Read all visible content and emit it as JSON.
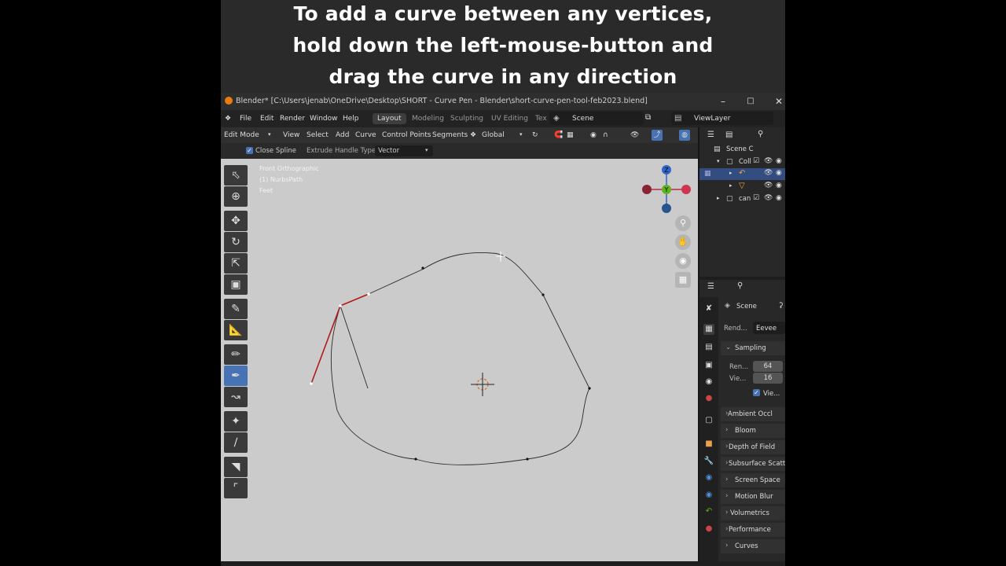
{
  "caption": {
    "line1": "To add a curve between any vertices,",
    "line2": "hold down the left-mouse-button and",
    "line3": "drag the curve in any direction"
  },
  "window": {
    "title": "Blender* [C:\\Users\\jenab\\OneDrive\\Desktop\\SHORT - Curve Pen - Blender\\short-curve-pen-tool-feb2023.blend]",
    "min_icon": "minimize-icon",
    "max_icon": "maximize-icon",
    "close_icon": "close-icon"
  },
  "menubar": {
    "items": [
      "File",
      "Edit",
      "Render",
      "Window",
      "Help"
    ],
    "workspaces": [
      "Layout",
      "Modeling",
      "Sculpting",
      "UV Editing",
      "Tex"
    ],
    "active_workspace": "Layout",
    "scene": "Scene",
    "view_layer": "ViewLayer"
  },
  "header": {
    "mode": "Edit Mode",
    "menus": [
      "View",
      "Select",
      "Add",
      "Curve",
      "Control Points",
      "Segments"
    ],
    "transform_orientation": "Global"
  },
  "tool_settings": {
    "close_spline_label": "Close Spline",
    "close_spline_checked": true,
    "extrude_label": "Extrude Handle Type:",
    "extrude_value": "Vector"
  },
  "viewport": {
    "view_name": "Front Orthographic",
    "object_name": "(1) NurbsPath",
    "units": "Feet",
    "gizmo_axes": {
      "z": "Z",
      "y": "Y"
    },
    "colors": {
      "background": "#cbcbcb",
      "curve": "#2a2a2a",
      "handle": "#b11a1a",
      "active_tool": "#4772b3"
    }
  },
  "outliner": {
    "rows": [
      "Scene C",
      "Coll",
      "",
      "",
      "can"
    ]
  },
  "properties": {
    "scene_label": "Scene",
    "render_engine_label": "Rend...",
    "render_engine_value": "Eevee",
    "sampling_label": "Sampling",
    "render_samples_label": "Ren...",
    "render_samples_value": "64",
    "viewport_samples_label": "Vie...",
    "viewport_samples_value": "16",
    "viewport_denoise_label": "Vie...",
    "panels": [
      "Ambient Occl",
      "Bloom",
      "Depth of Field",
      "Subsurface Scatt",
      "Screen Space",
      "Motion Blur",
      "Volumetrics",
      "Performance",
      "Curves"
    ]
  }
}
